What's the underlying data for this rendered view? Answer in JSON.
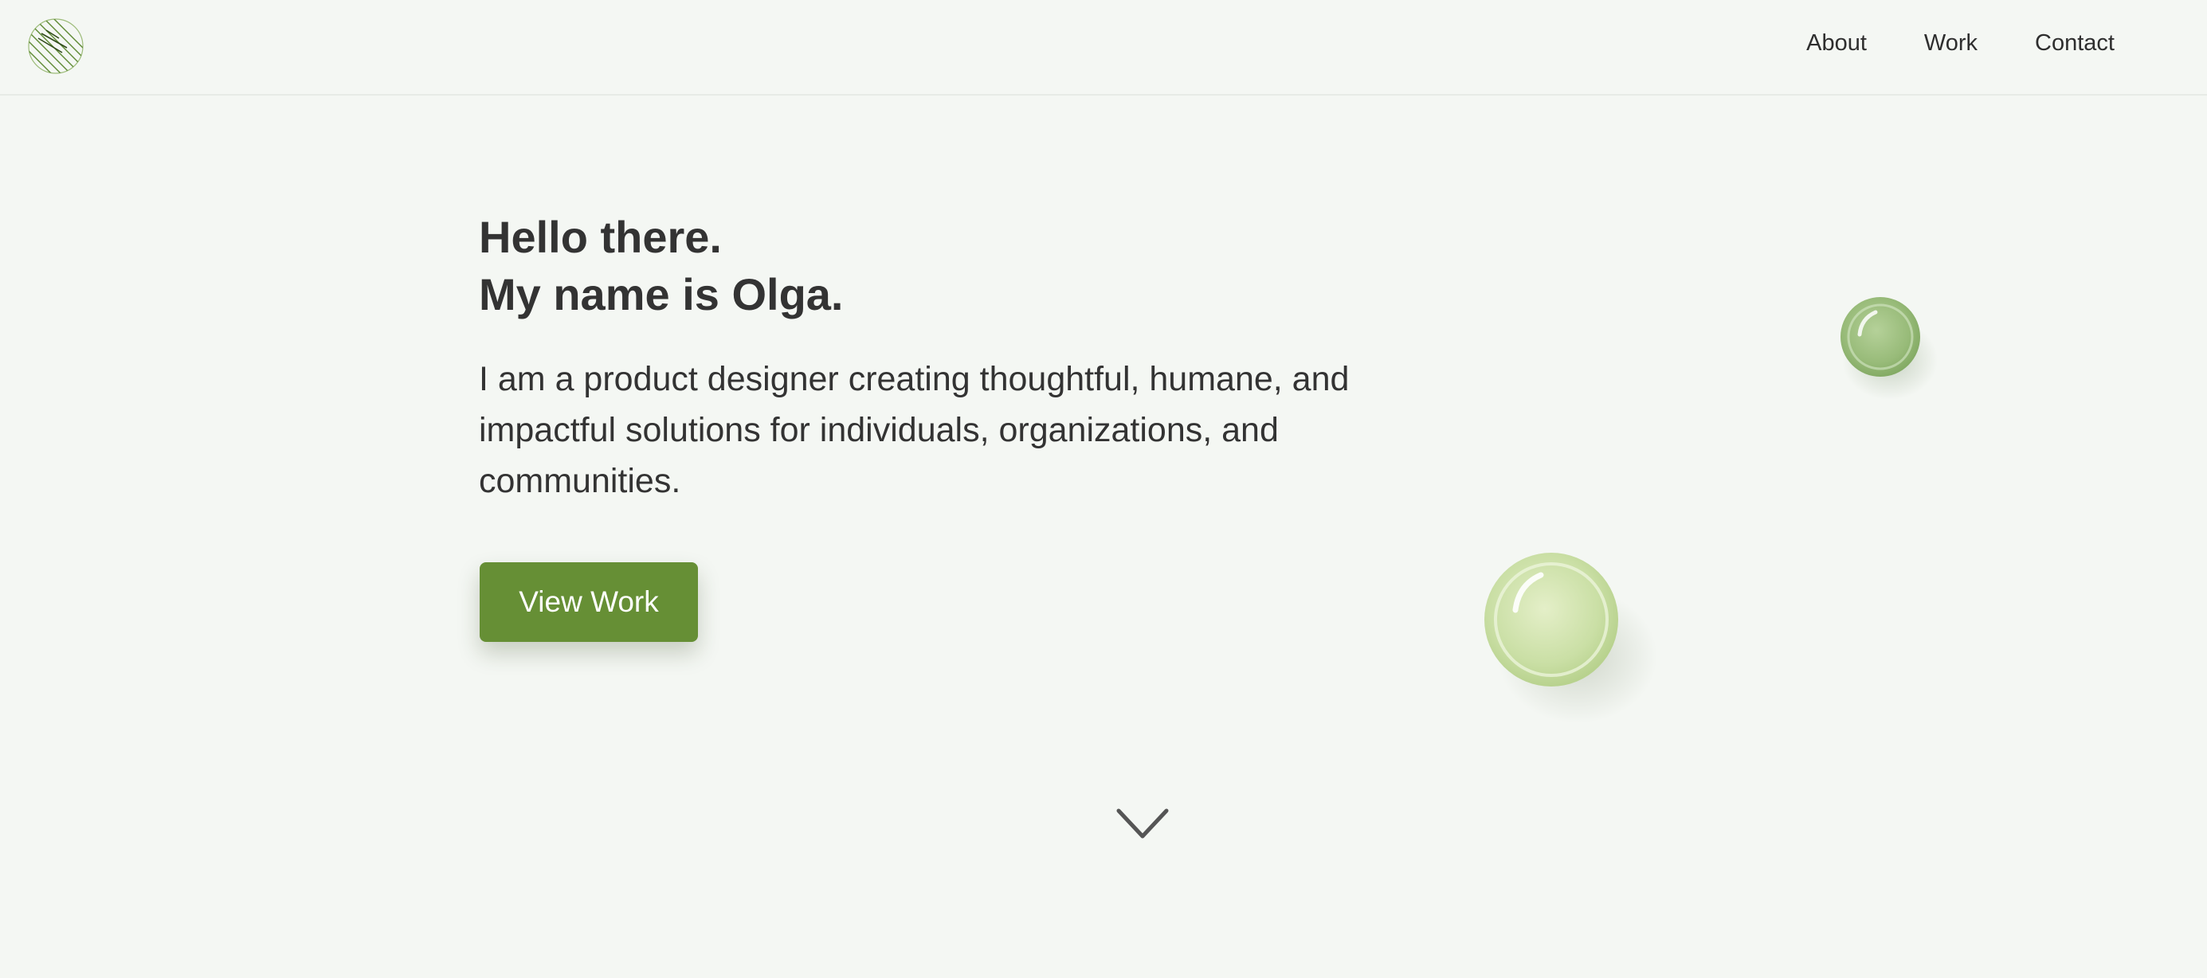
{
  "header": {
    "logo_icon": "hatched-circle-logo",
    "nav": [
      {
        "label": "About"
      },
      {
        "label": "Work"
      },
      {
        "label": "Contact"
      }
    ]
  },
  "hero": {
    "greeting_line1": "Hello there.",
    "greeting_line2": "My name is Olga.",
    "intro": "I am a product designer creating thoughtful, humane, and impactful solutions for individuals, organizations, and communities.",
    "cta_label": "View Work"
  },
  "decor": {
    "bubble_icon": "glass-bubble",
    "scroll_icon": "chevron-down-icon"
  },
  "colors": {
    "background": "#f4f7f3",
    "accent": "#668f35",
    "text": "#333333",
    "bubble_small": "#97bb78",
    "bubble_large": "#c8dea2"
  }
}
